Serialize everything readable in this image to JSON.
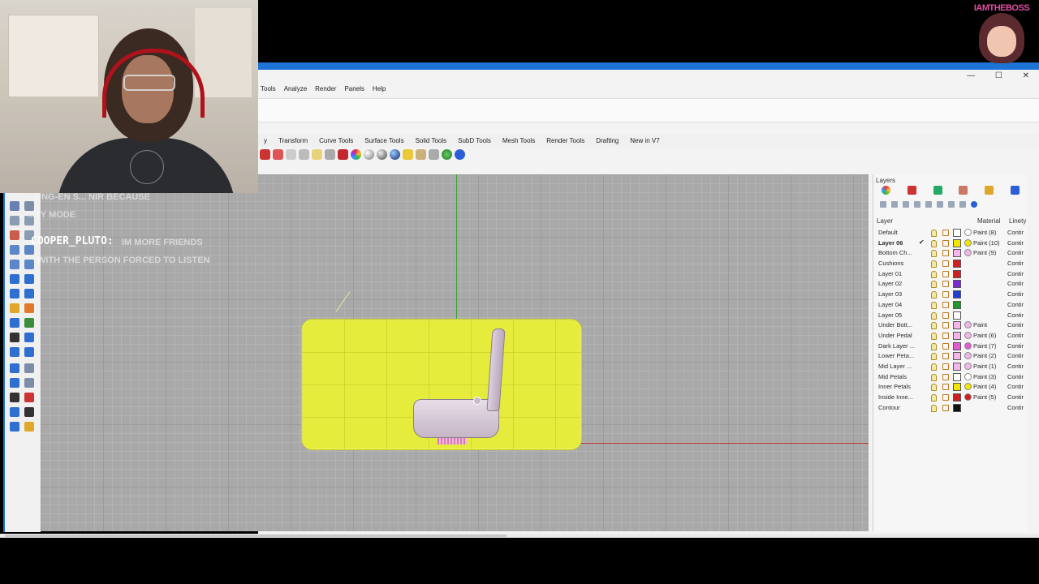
{
  "window": {
    "minimize_glyph": "—",
    "maximize_glyph": "☐",
    "close_glyph": "✕",
    "accent": "#1e74d6"
  },
  "overlay": {
    "streamer_tag": "IAMTHEBOSS"
  },
  "menu": [
    "Tools",
    "Analyze",
    "Render",
    "Panels",
    "Help"
  ],
  "tabs": [
    "y",
    "Transform",
    "Curve Tools",
    "Surface Tools",
    "Solid Tools",
    "SubD Tools",
    "Mesh Tools",
    "Render Tools",
    "Drafting",
    "New in V7"
  ],
  "chat": {
    "line1": "...UNG-EN S... NIR BECAUSE",
    "line2": "...TY MODE",
    "username": "COOPER_PLUTO:",
    "message1": "IM MORE FRIENDS",
    "message2": "WITH THE PERSON FORCED TO LISTEN"
  },
  "viewport": {
    "grid_color": "#a9a9a9",
    "highlight_color": "#e6ec3c",
    "x_axis_color": "#b03030",
    "y_axis_color": "#3ca03c"
  },
  "layers_panel": {
    "title": "Layers",
    "columns": {
      "layer": "Layer",
      "material": "Material",
      "linetype": "Linety"
    },
    "rows": [
      {
        "name": "Default",
        "color": "#ffffff",
        "material_color": "#ffffff",
        "material": "Paint (8)",
        "linetype": "Contir",
        "current": false
      },
      {
        "name": "Layer 06",
        "color": "#f2e600",
        "material_color": "#f2e600",
        "material": "Paint (10)",
        "linetype": "Contir",
        "current": true
      },
      {
        "name": "Bottom Ch...",
        "color": "#f2b6ea",
        "material_color": "#f2b6ea",
        "material": "Paint (9)",
        "linetype": "Contir",
        "current": false
      },
      {
        "name": "Cushions",
        "color": "#d11f1f",
        "material_color": "",
        "material": "",
        "linetype": "Contir",
        "current": false
      },
      {
        "name": "Layer 01",
        "color": "#d11f1f",
        "material_color": "",
        "material": "",
        "linetype": "Contir",
        "current": false
      },
      {
        "name": "Layer 02",
        "color": "#7c2ad6",
        "material_color": "",
        "material": "",
        "linetype": "Contir",
        "current": false
      },
      {
        "name": "Layer 03",
        "color": "#1f3fd6",
        "material_color": "",
        "material": "",
        "linetype": "Contir",
        "current": false
      },
      {
        "name": "Layer 04",
        "color": "#1f9a2a",
        "material_color": "",
        "material": "",
        "linetype": "Contir",
        "current": false
      },
      {
        "name": "Layer 05",
        "color": "#ffffff",
        "material_color": "",
        "material": "",
        "linetype": "Contir",
        "current": false
      },
      {
        "name": "Under Bott...",
        "color": "#f2b6ea",
        "material_color": "#f2b6ea",
        "material": "Paint",
        "linetype": "Contir",
        "current": false
      },
      {
        "name": "Under Pedal",
        "color": "#f2b6ea",
        "material_color": "#f2b6ea",
        "material": "Paint (6)",
        "linetype": "Contir",
        "current": false
      },
      {
        "name": "Dark Layer ...",
        "color": "#e25bd0",
        "material_color": "#e25bd0",
        "material": "Paint (7)",
        "linetype": "Contir",
        "current": false
      },
      {
        "name": "Lower Peta...",
        "color": "#f2b6ea",
        "material_color": "#f2b6ea",
        "material": "Paint (2)",
        "linetype": "Contir",
        "current": false
      },
      {
        "name": "Mid Layer ...",
        "color": "#f2b6ea",
        "material_color": "#f2b6ea",
        "material": "Paint (1)",
        "linetype": "Contir",
        "current": false
      },
      {
        "name": "Mid Petals",
        "color": "#ffffff",
        "material_color": "#ffffff",
        "material": "Paint (3)",
        "linetype": "Contir",
        "current": false
      },
      {
        "name": "Inner Petals",
        "color": "#f2e600",
        "material_color": "#f2e600",
        "material": "Paint (4)",
        "linetype": "Contir",
        "current": false
      },
      {
        "name": "Inside Inne...",
        "color": "#d11f1f",
        "material_color": "#d11f1f",
        "material": "Paint (5)",
        "linetype": "Contir",
        "current": false
      },
      {
        "name": "Contour",
        "color": "#111111",
        "material_color": "",
        "material": "",
        "linetype": "Contir",
        "current": false
      }
    ]
  }
}
